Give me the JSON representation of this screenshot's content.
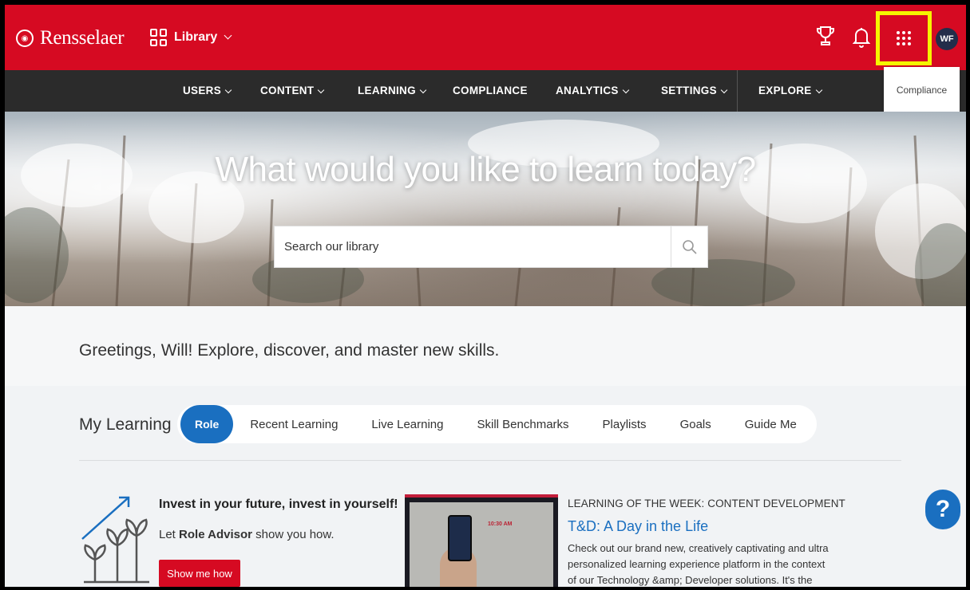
{
  "header": {
    "brand": "Rensselaer",
    "library_label": "Library"
  },
  "nav": {
    "items": [
      "USERS",
      "CONTENT",
      "LEARNING",
      "COMPLIANCE",
      "ANALYTICS",
      "SETTINGS",
      "EXPLORE"
    ]
  },
  "user": {
    "initials": "WF"
  },
  "tooltip": "Compliance",
  "hero": {
    "title": "What would you like to learn today?",
    "search_placeholder": "Search our library"
  },
  "greeting": "Greetings, Will! Explore, discover, and master new skills.",
  "my_learning": {
    "label": "My Learning",
    "tabs": [
      "Role",
      "Recent Learning",
      "Live Learning",
      "Skill Benchmarks",
      "Playlists",
      "Goals",
      "Guide Me"
    ]
  },
  "role_advisor": {
    "title": "Invest in your future, invest in yourself!",
    "sub_prefix": "Let ",
    "sub_bold": "Role Advisor",
    "sub_suffix": " show you how.",
    "button": "Show me how"
  },
  "lotw": {
    "kicker": "LEARNING OF THE WEEK: CONTENT DEVELOPMENT",
    "title": "T&D: A Day in the Life",
    "description": "Check out our brand new, creatively captivating and ultra personalized learning experience platform in the context of our Technology &amp; Developer solutions. It's the best of...",
    "thumb_time": "10:30 AM"
  },
  "help_label": "?",
  "colors": {
    "brand_red": "#d60a22",
    "nav_dark": "#2b2b2b",
    "accent_blue": "#1a6fc0",
    "highlight": "#f5f500"
  }
}
